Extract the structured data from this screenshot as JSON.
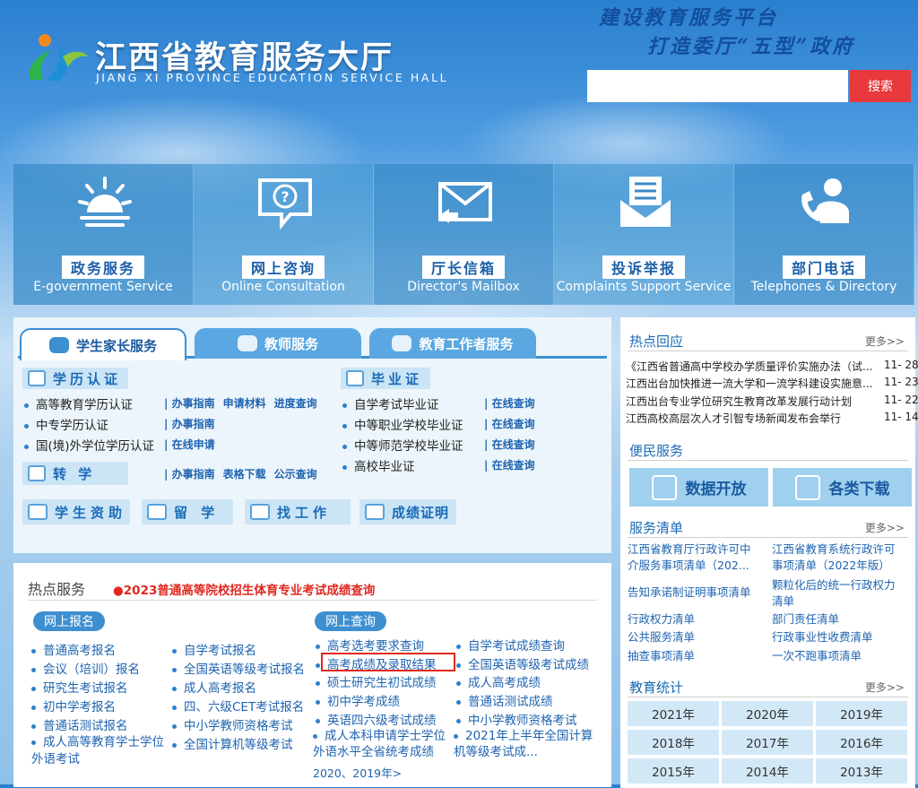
{
  "header": {
    "title": "江西省教育服务大厅",
    "subtitle": "JIANG XI PROVINCE EDUCATION SERVICE HALL",
    "slogan_line1": "建设教育服务平台",
    "slogan_line2": "打造委厅“五型”政府",
    "search_placeholder": "",
    "search_button": "搜索"
  },
  "services": [
    {
      "cn": "政务服务",
      "en": "E-government Service",
      "icon": "sunrise-icon"
    },
    {
      "cn": "网上咨询",
      "en": "Online Consultation",
      "icon": "question-bubble-icon"
    },
    {
      "cn": "厅长信箱",
      "en": "Director's Mailbox",
      "icon": "mail-icon"
    },
    {
      "cn": "投诉举报",
      "en": "Complaints Support Service",
      "icon": "complaint-envelope-icon"
    },
    {
      "cn": "部门电话",
      "en": "Telephones & Directory",
      "icon": "phone-icon"
    }
  ],
  "tabs": [
    "学生家长服务",
    "教师服务",
    "教育工作者服务"
  ],
  "student": {
    "xueli": {
      "label": "学历认证",
      "items": [
        {
          "text": "高等教育学历认证",
          "links": [
            "办事指南",
            "申请材料",
            "进度查询"
          ]
        },
        {
          "text": "中专学历认证",
          "links": [
            "办事指南"
          ]
        },
        {
          "text": "国(境)外学位学历认证",
          "links": [
            "在线申请"
          ]
        }
      ]
    },
    "biye": {
      "label": "毕业证",
      "items": [
        {
          "text": "自学考试毕业证",
          "links": [
            "在线查询"
          ]
        },
        {
          "text": "中等职业学校毕业证",
          "links": [
            "在线查询"
          ]
        },
        {
          "text": "中等师范学校毕业证",
          "links": [
            "在线查询"
          ]
        },
        {
          "text": "高校毕业证",
          "links": [
            "在线查询"
          ]
        }
      ]
    },
    "zhuanxue": {
      "label": "转 学",
      "links": [
        "办事指南",
        "表格下载",
        "公示查询"
      ]
    },
    "buttons": [
      "学生资助",
      "留 学",
      "找工作",
      "成绩证明"
    ]
  },
  "hot_services": {
    "title": "热点服务",
    "notice": "●2023普通高等院校招生体育专业考试成绩查询",
    "online_signup": {
      "label": "网上报名",
      "col1": [
        "普通高考报名",
        "会议（培训）报名",
        "研究生考试报名",
        "初中学考报名",
        "普通话测试报名",
        "成人高等教育学士学位外语考试"
      ],
      "col2": [
        "自学考试报名",
        "全国英语等级考试报名",
        "成人高考报名",
        "四、六级CET考试报名",
        "中小学教师资格考试",
        "全国计算机等级考试"
      ]
    },
    "online_query": {
      "label": "网上查询",
      "col1": [
        "高考选考要求查询",
        "高考成绩及录取结果",
        "硕士研究生初试成绩",
        "初中学考成绩",
        "英语四六级考试成绩",
        "成人本科申请学士学位外语水平全省统考成绩"
      ],
      "col2": [
        "自学考试成绩查询",
        "全国英语等级考试成绩",
        "成人高考成绩",
        "普通话测试成绩",
        "中小学教师资格考试",
        "2021年上半年全国计算机等级考试成..."
      ],
      "extra": "2020、2019年>"
    }
  },
  "right": {
    "hot_reply": {
      "title": "热点回应",
      "more": "更多>>",
      "items": [
        {
          "text": "《江西省普通高中学校办学质量评价实施办法（试...",
          "date": "11- 28"
        },
        {
          "text": "江西出台加快推进一流大学和一流学科建设实施意...",
          "date": "11- 23"
        },
        {
          "text": "江西出台专业学位研究生教育改革发展行动计划",
          "date": "11- 22"
        },
        {
          "text": "江西高校高层次人才引智专场新闻发布会举行",
          "date": "11- 14"
        }
      ]
    },
    "bianmin": {
      "title": "便民服务",
      "tiles": [
        "数据开放",
        "各类下载"
      ]
    },
    "qingdan": {
      "title": "服务清单",
      "more": "更多>>",
      "col1": [
        "江西省教育厅行政许可中介服务事项清单（202...",
        "告知承诺制证明事项清单",
        "行政权力清单",
        "公共服务清单",
        "抽查事项清单"
      ],
      "col2": [
        "江西省教育系统行政许可事项清单（2022年版）",
        "颗粒化后的统一行政权力清单",
        "部门责任清单",
        "行政事业性收费清单",
        "一次不跑事项清单"
      ]
    },
    "stats": {
      "title": "教育统计",
      "more": "更多>>",
      "years": [
        "2021年",
        "2020年",
        "2019年",
        "2018年",
        "2017年",
        "2016年",
        "2015年",
        "2014年",
        "2013年"
      ]
    }
  }
}
